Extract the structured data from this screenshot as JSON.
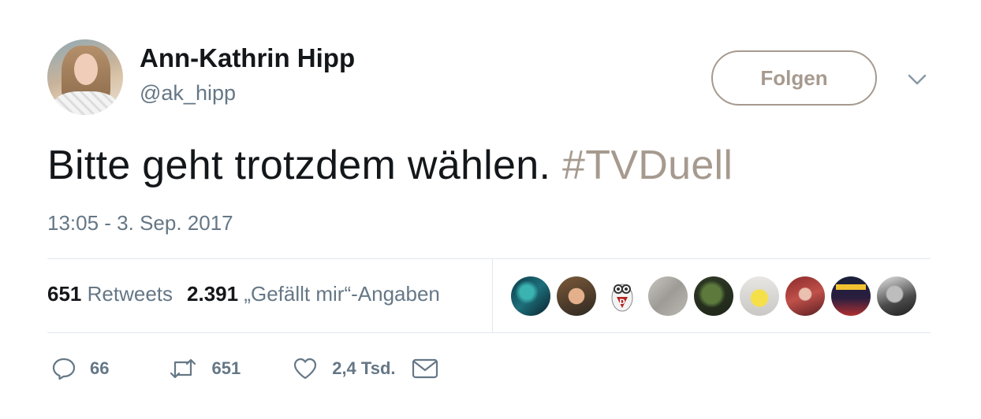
{
  "author": {
    "display_name": "Ann-Kathrin Hipp",
    "handle": "@ak_hipp"
  },
  "follow_button": {
    "label": "Folgen"
  },
  "tweet": {
    "text": "Bitte geht trotzdem wählen.",
    "hashtag": "#TVDuell",
    "timestamp": "13:05 - 3. Sep. 2017"
  },
  "stats": {
    "retweets_count": "651",
    "retweets_label": "Retweets",
    "likes_count": "2.391",
    "likes_label": "„Gefällt mir“-Angaben"
  },
  "liked_by_avatars": [
    {
      "icon": "avatar-fantasy-art"
    },
    {
      "icon": "avatar-man-glasses"
    },
    {
      "icon": "avatar-minion-logo"
    },
    {
      "icon": "avatar-grey-texture"
    },
    {
      "icon": "avatar-frog"
    },
    {
      "icon": "avatar-chick"
    },
    {
      "icon": "avatar-red-hair-woman"
    },
    {
      "icon": "avatar-cobra-poster"
    },
    {
      "icon": "avatar-bw-man"
    }
  ],
  "actions": {
    "reply_count": "66",
    "retweet_count": "651",
    "like_count": "2,4 Tsd."
  },
  "colors": {
    "accent": "#a69a8f",
    "text_primary": "#14171a",
    "text_secondary": "#657786",
    "divider": "#e1e8ed"
  }
}
